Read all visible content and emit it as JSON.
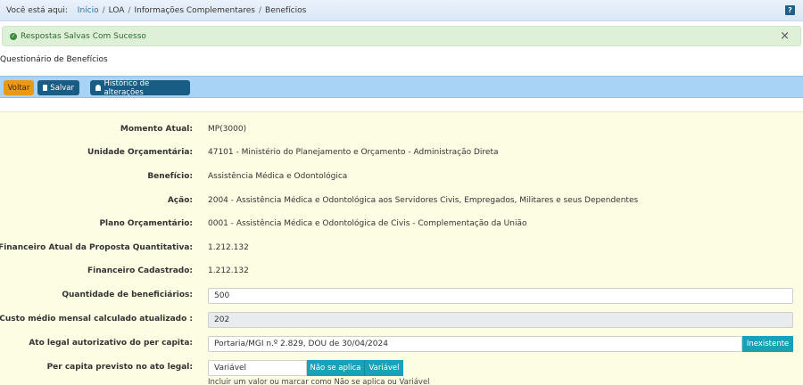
{
  "breadcrumb": {
    "prefix": "Você está aqui",
    "items": [
      "Início",
      "LOA",
      "Informações Complementares",
      "Benefícios"
    ]
  },
  "help_icon": "?",
  "alert": {
    "message": "Respostas Salvas Com Sucesso",
    "close": "×"
  },
  "page_title": "Questionário de Benefícios",
  "toolbar": {
    "voltar": "Voltar",
    "salvar": "Salvar",
    "historico": "Histórico de alterações"
  },
  "form": {
    "momento_atual": {
      "label": "Momento Atual:",
      "value": "MP(3000)"
    },
    "unidade": {
      "label": "Unidade Orçamentária:",
      "value": "47101 - Ministério do Planejamento e Orçamento - Administração Direta"
    },
    "beneficio": {
      "label": "Benefício:",
      "value": "Assistência Médica e Odontológica"
    },
    "acao": {
      "label": "Ação:",
      "value": "2004 - Assistência Médica e Odontológica aos Servidores Civis, Empregados, Militares e seus Dependentes"
    },
    "plano": {
      "label": "Plano Orçamentário:",
      "value": "0001 - Assistência Médica e Odontológica de Civis - Complementação da União"
    },
    "financeiro_atual": {
      "label": "Financeiro Atual da Proposta Quantitativa:",
      "value": "1.212.132"
    },
    "financeiro_cadastrado": {
      "label": "Financeiro Cadastrado:",
      "value": "1.212.132"
    },
    "quantidade": {
      "label": "Quantidade de beneficiários:",
      "value": "500"
    },
    "custo_medio": {
      "label": "Custo médio mensal calculado atualizado :",
      "value": "202"
    },
    "ato_legal": {
      "label": "Ato legal autorizativo do per capita:",
      "value": "Portaria/MGI n.º 2.829, DOU de 30/04/2024",
      "addon": "Inexistente"
    },
    "per_capita": {
      "label": "Per capita previsto no ato legal:",
      "value": "Variável",
      "addon_nao_aplica": "Não se aplica",
      "addon_variavel": "Variável",
      "help": "Incluir um valor ou marcar como Não se aplica ou Variável"
    }
  }
}
